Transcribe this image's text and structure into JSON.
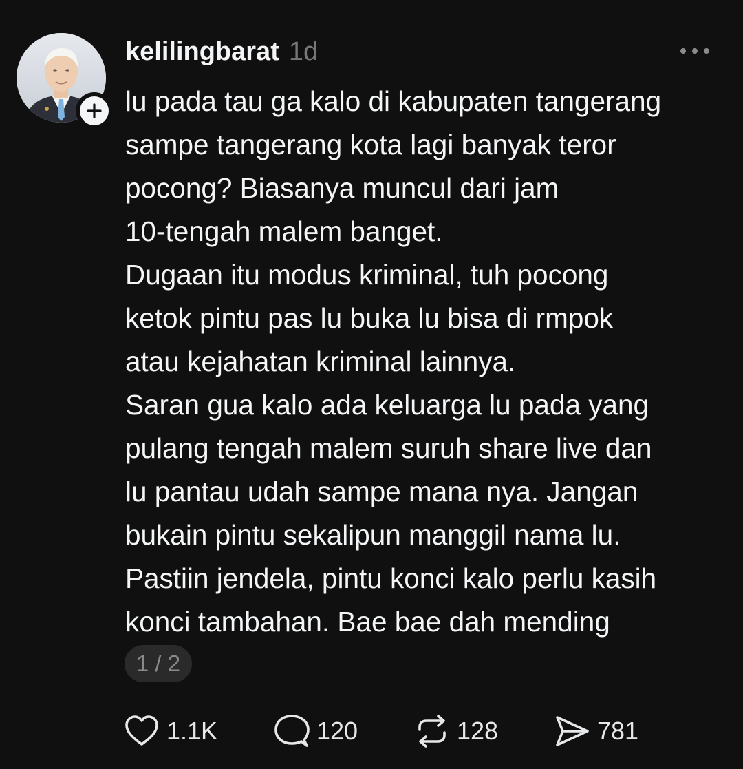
{
  "post": {
    "username": "kelilingbarat",
    "timestamp": "1d",
    "body_lines": [
      "lu pada tau ga kalo di kabupaten tangerang",
      "sampe tangerang kota lagi banyak teror",
      "pocong? Biasanya muncul dari jam",
      "10-tengah malem banget.",
      "Dugaan itu modus kriminal, tuh pocong",
      "ketok pintu pas lu buka lu bisa di rmpok",
      "atau kejahatan kriminal lainnya.",
      "Saran gua kalo ada keluarga lu pada yang",
      "pulang tengah malem suruh share live dan",
      "lu pantau udah sampe mana nya. Jangan",
      "bukain pintu sekalipun manggil nama lu.",
      "Pastiin jendela, pintu konci kalo perlu kasih",
      "konci tambahan. Bae bae dah mending"
    ],
    "page_indicator": "1 / 2"
  },
  "actions": {
    "likes": "1.1K",
    "replies": "120",
    "reposts": "128",
    "shares": "781"
  },
  "icons": {
    "avatar": "profile-photo",
    "follow": "plus-icon",
    "more": "more-dots-icon",
    "like": "heart-icon",
    "reply": "comment-icon",
    "repost": "repost-icon",
    "share": "send-icon"
  },
  "colors": {
    "background": "#101010",
    "text": "#f3f5f7",
    "muted": "#777777",
    "pill": "#2a2a2a"
  }
}
